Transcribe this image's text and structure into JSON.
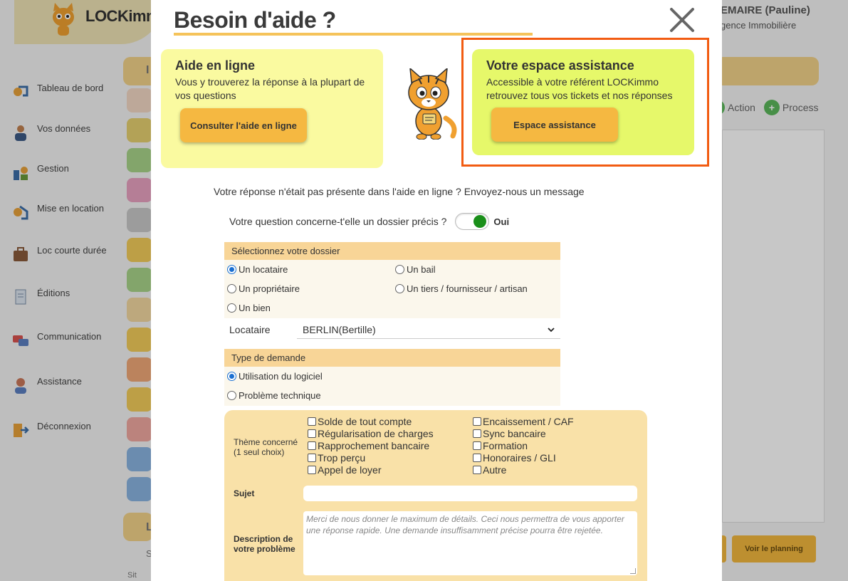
{
  "app": {
    "logo_text": "LOCKimmo",
    "user_name": "EMAIRE (Pauline)",
    "user_agency": "gence Immobilière"
  },
  "sidebar": {
    "items": [
      {
        "label": "Tableau de bord",
        "icon": "dashboard-icon"
      },
      {
        "label": "Vos données",
        "icon": "user-icon"
      },
      {
        "label": "Gestion",
        "icon": "management-icon"
      },
      {
        "label": "Mise en location",
        "icon": "rental-icon"
      },
      {
        "label": "Loc courte durée",
        "icon": "suitcase-icon"
      },
      {
        "label": "Éditions",
        "icon": "document-icon"
      },
      {
        "label": "Communication",
        "icon": "chat-icon"
      },
      {
        "label": "Assistance",
        "icon": "support-agent-icon"
      },
      {
        "label": "Déconnexion",
        "icon": "logout-icon"
      }
    ]
  },
  "background": {
    "header_letter": "I",
    "action_label": "Action",
    "process_label": "Process",
    "planning_button": "Voir le planning",
    "lower_letter": "L",
    "lower_sub": "S",
    "broken_image_text": "Sit"
  },
  "modal": {
    "title": "Besoin d'aide ?",
    "help_card": {
      "title": "Aide en ligne",
      "text": "Vous y trouverez la réponse à la plupart de vos questions",
      "button": "Consulter l'aide en ligne"
    },
    "assist_card": {
      "title": "Votre espace assistance",
      "text": "Accessible à votre référent LOCKimmo retrouvez tous vos tickets et nos réponses",
      "button": "Espace assistance"
    },
    "intro": "Votre réponse n'était pas présente dans l'aide en ligne ? Envoyez-nous un message",
    "question": "Votre question concerne-t'elle un dossier précis ?",
    "toggle_label": "Oui",
    "dossier_section": {
      "title": "Sélectionnez votre dossier",
      "options": [
        "Un locataire",
        "Un bail",
        "Un propriétaire",
        "Un tiers / fournisseur / artisan",
        "Un bien"
      ],
      "selected": "Un locataire"
    },
    "locataire": {
      "label": "Locataire",
      "value": "BERLIN(Bertille)"
    },
    "type_section": {
      "title": "Type de demande",
      "options": [
        "Utilisation du logiciel",
        "Problème technique"
      ],
      "selected": "Utilisation du logiciel"
    },
    "theme": {
      "label": "Thème concerné",
      "sublabel": "(1 seul choix)",
      "options_left": [
        "Solde de tout compte",
        "Régularisation de charges",
        "Rapprochement bancaire",
        "Trop perçu",
        "Appel de loyer"
      ],
      "options_right": [
        "Encaissement / CAF",
        "Sync bancaire",
        "Formation",
        "Honoraires / GLI",
        "Autre"
      ]
    },
    "subject": {
      "label": "Sujet",
      "value": ""
    },
    "description": {
      "label_line1": "Description de",
      "label_line2": "votre problème",
      "placeholder": "Merci de nous donner le maximum de détails. Ceci nous permettra de vous apporter une réponse rapide. Une demande insuffisamment précise pourra être rejetée."
    }
  },
  "colors": {
    "accent_orange": "#f5b841",
    "highlight_border": "#f25c12",
    "help_card_bg": "#fafaa0",
    "assist_card_bg": "#e6f86a",
    "section_header": "#f8d597",
    "form_box": "#f9e1a8",
    "toggle_on": "#1a8f1a"
  }
}
